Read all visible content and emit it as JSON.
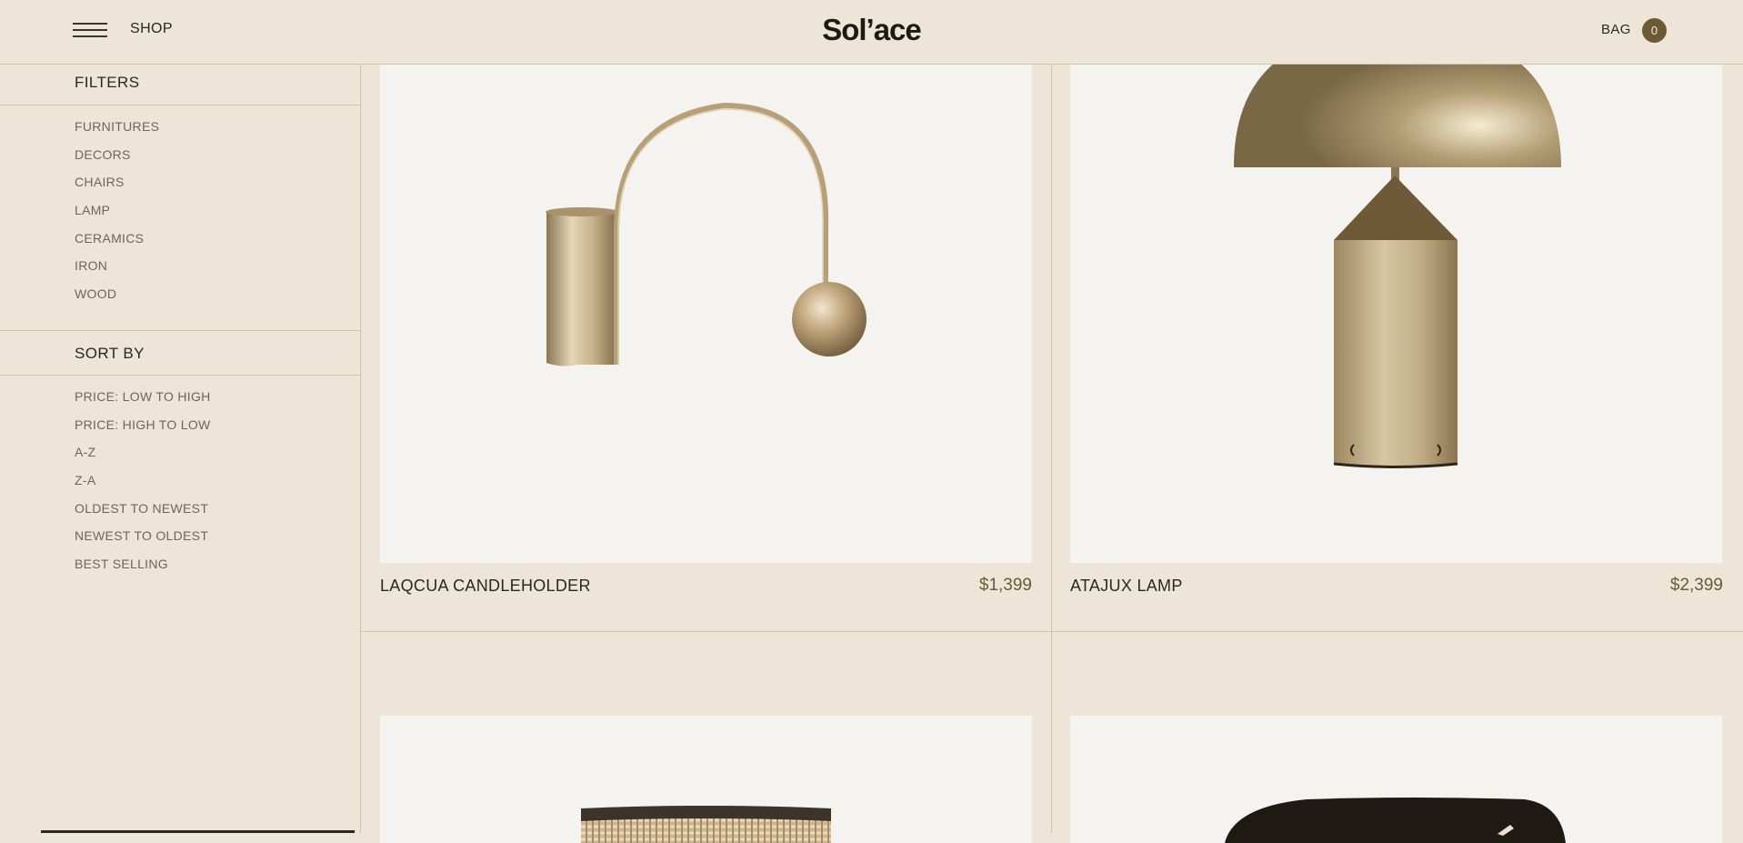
{
  "header": {
    "shop_label": "SHOP",
    "logo_text": "Sol’ace",
    "bag_label": "BAG",
    "bag_count": "0"
  },
  "filters": {
    "title": "FILTERS",
    "items": [
      "FURNITURES",
      "DECORS",
      "CHAIRS",
      "LAMP",
      "CERAMICS",
      "IRON",
      "WOOD"
    ]
  },
  "sort": {
    "title": "SORT BY",
    "items": [
      "PRICE: LOW TO HIGH",
      "PRICE: HIGH TO LOW",
      "A-Z",
      "Z-A",
      "OLDEST TO NEWEST",
      "NEWEST TO OLDEST",
      "BEST SELLING"
    ]
  },
  "products": [
    {
      "name": "LAQCUA CANDLEHOLDER",
      "price": "$1,399"
    },
    {
      "name": "ATAJUX LAMP",
      "price": "$2,399"
    }
  ],
  "colors": {
    "background": "#ede6d8",
    "accent": "#6b5a33",
    "card_background": "#f5f3f0"
  }
}
